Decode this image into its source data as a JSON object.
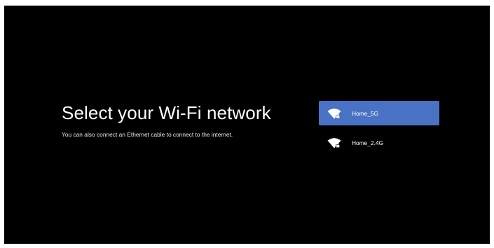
{
  "screen": {
    "title": "Select your Wi-Fi network",
    "subtitle": "You can also connect an Ethernet cable to connect to the internet."
  },
  "networks": [
    {
      "name": "Home_5G",
      "secured": true,
      "selected": true,
      "icon": "wifi-lock-icon"
    },
    {
      "name": "Home_2.4G",
      "secured": true,
      "selected": false,
      "icon": "wifi-lock-icon"
    }
  ],
  "colors": {
    "background": "#000000",
    "selected_highlight": "#4a72c4",
    "text": "#ffffff"
  }
}
